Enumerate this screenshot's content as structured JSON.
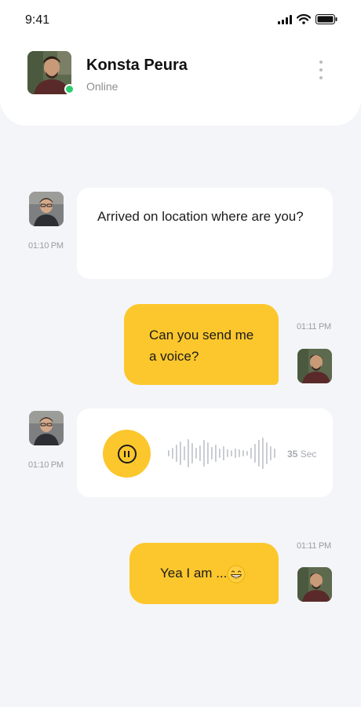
{
  "status_bar": {
    "time": "9:41"
  },
  "contact": {
    "name": "Konsta Peura",
    "status": "Online"
  },
  "messages": [
    {
      "text": "Arrived on location where are you?",
      "time": "01:10 PM",
      "direction": "incoming"
    },
    {
      "text": "Can you send me a voice?",
      "time": "01:11 PM",
      "direction": "outgoing"
    },
    {
      "type": "voice",
      "duration_value": "35",
      "duration_unit": "Sec",
      "time": "01:10 PM",
      "direction": "incoming"
    },
    {
      "text": "Yea I am ...",
      "time": "01:11 PM",
      "direction": "outgoing",
      "emoji": "grinning-face"
    }
  ],
  "colors": {
    "accent": "#fcc72c",
    "online": "#2ecc71",
    "background": "#f4f5f9"
  },
  "icons": [
    "signal-icon",
    "wifi-icon",
    "battery-icon",
    "more-vertical-icon",
    "pause-icon",
    "grinning-face-emoji"
  ]
}
